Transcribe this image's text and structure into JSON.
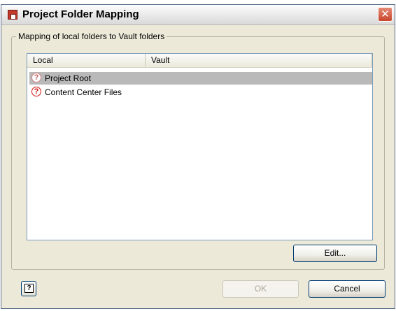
{
  "window": {
    "title": "Project Folder Mapping",
    "close_glyph": "✕"
  },
  "group": {
    "label": "Mapping of local folders to Vault folders"
  },
  "list": {
    "columns": [
      "Local",
      "Vault"
    ],
    "rows": [
      {
        "local": "Project Root",
        "vault": "",
        "icon": "question-mark-icon",
        "selected": true
      },
      {
        "local": "Content Center Files",
        "vault": "",
        "icon": "question-mark-icon",
        "selected": false
      }
    ]
  },
  "buttons": {
    "edit": "Edit...",
    "ok": "OK",
    "cancel": "Cancel",
    "help_glyph": "?",
    "question_glyph": "?"
  },
  "colors": {
    "window_bg": "#ece9d8",
    "selection": "#b9b9b9",
    "icon_red": "#d01010"
  }
}
